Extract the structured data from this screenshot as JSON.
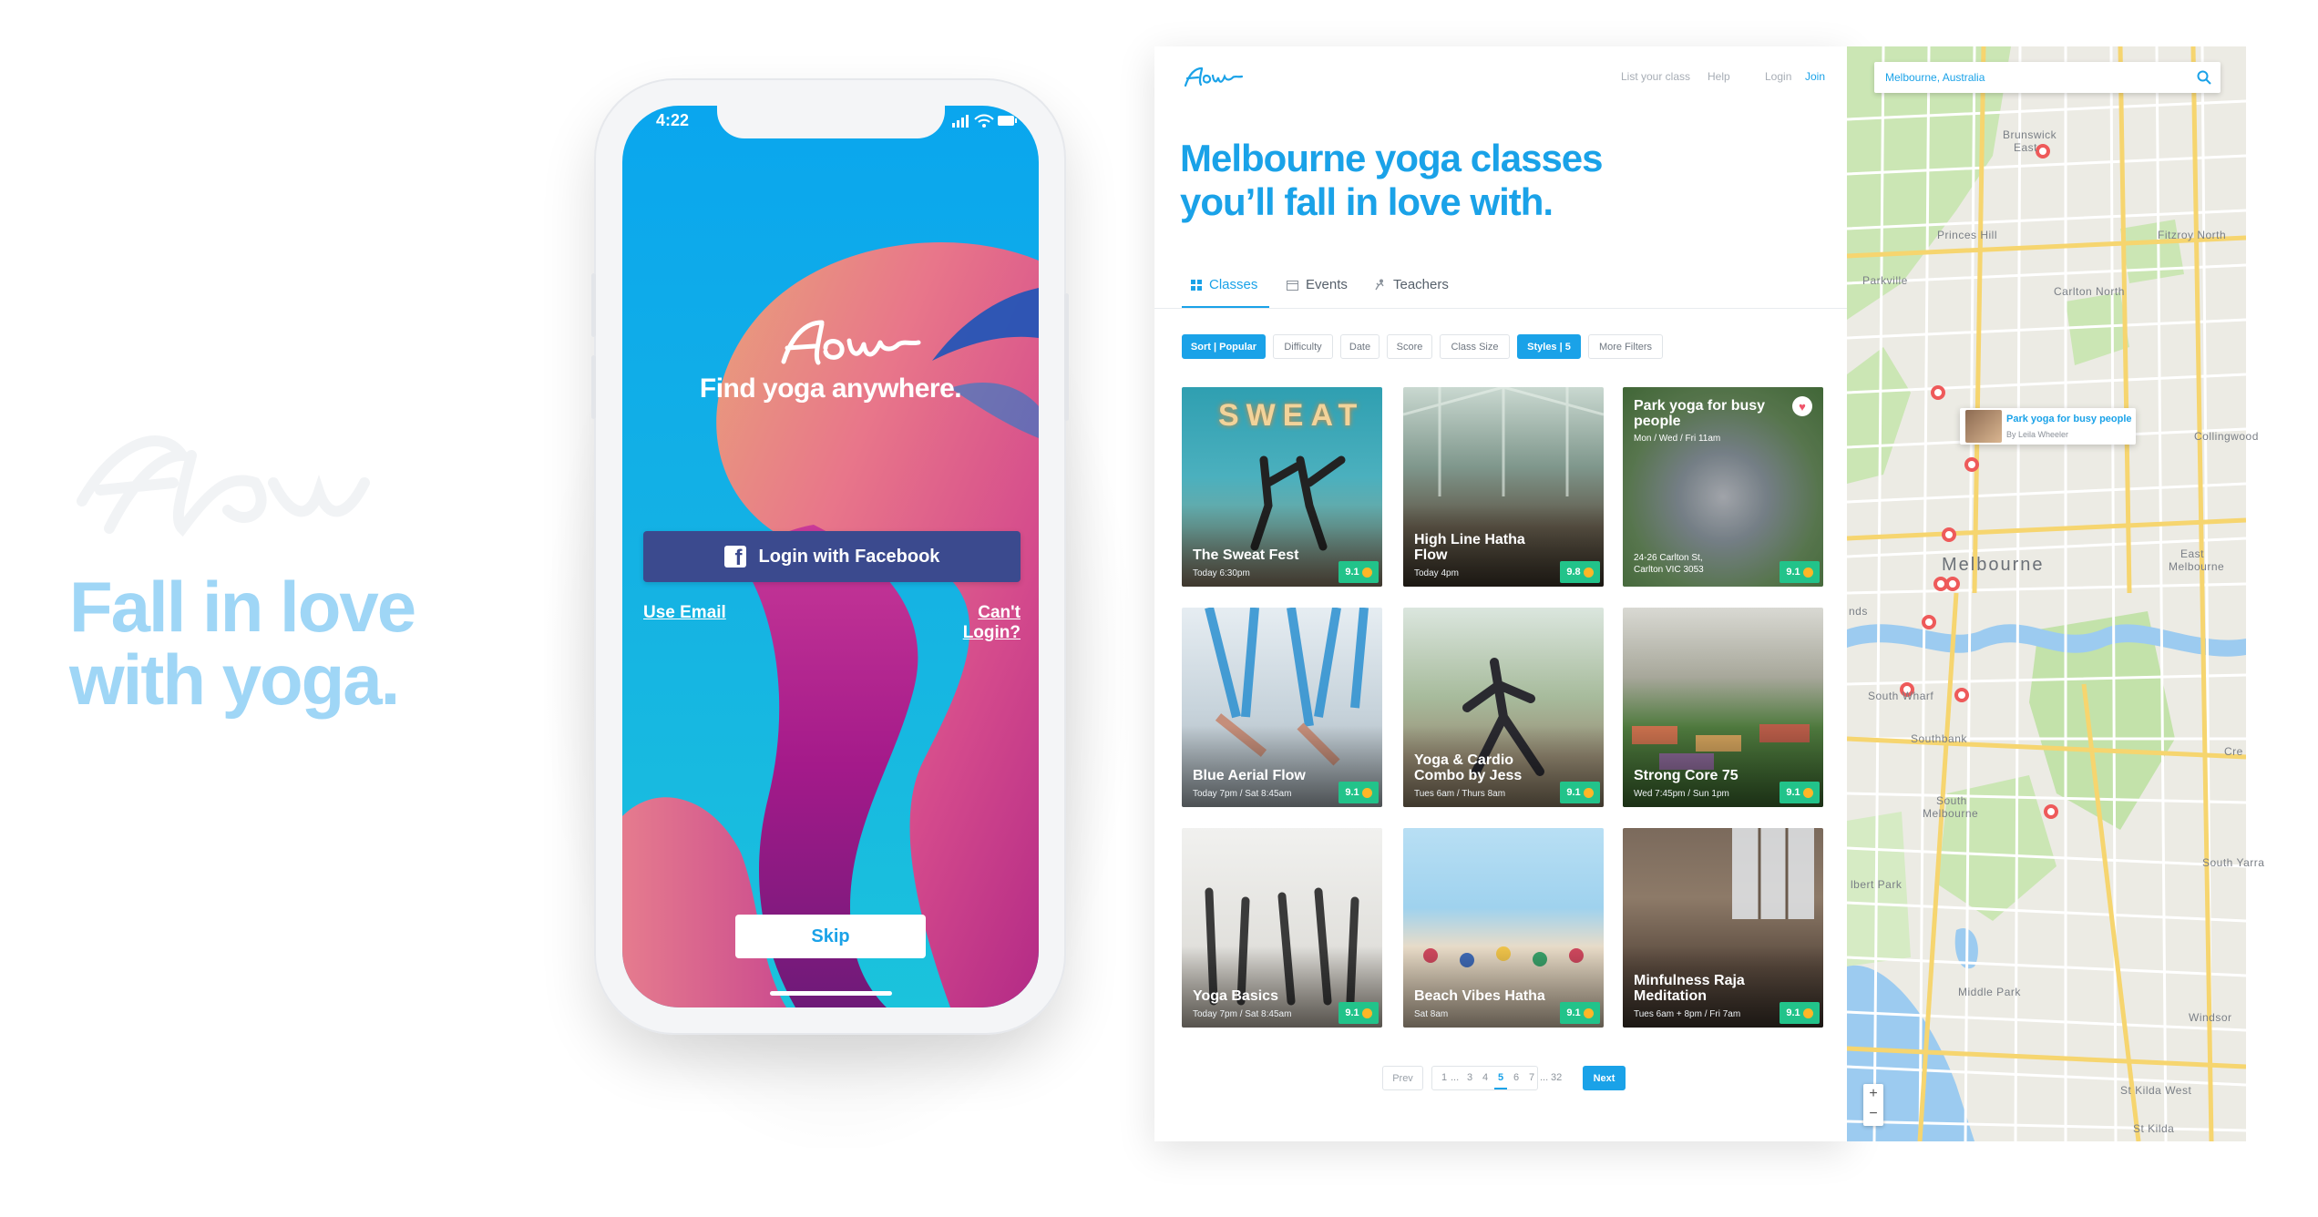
{
  "tagline": {
    "line1": "Fall in love",
    "line2": "with yoga."
  },
  "phone": {
    "status_time": "4:22",
    "app_name": "Flow",
    "subtitle": "Find yoga anywhere.",
    "facebook_label": "Login with Facebook",
    "use_email": "Use Email",
    "cant_login": "Can't Login?",
    "skip": "Skip"
  },
  "site": {
    "logo": "Flow",
    "nav": {
      "list_class": "List your class",
      "help": "Help",
      "login": "Login",
      "join": "Join"
    },
    "hero": {
      "line1": "Melbourne yoga classes",
      "line2": "you’ll fall in love with."
    },
    "tabs": [
      {
        "label": "Classes",
        "icon": "grid-icon"
      },
      {
        "label": "Events",
        "icon": "calendar-icon"
      },
      {
        "label": "Teachers",
        "icon": "person-icon"
      }
    ],
    "filters": {
      "sort": "Sort | Popular",
      "difficulty": "Difficulty",
      "date": "Date",
      "score": "Score",
      "class_size": "Class Size",
      "styles": "Styles | 5",
      "more": "More Filters"
    },
    "cards": [
      {
        "title": "The Sweat Fest",
        "time": "Today 6:30pm",
        "score": "9.1",
        "sign": "SWEAT"
      },
      {
        "title": "High Line Hatha Flow",
        "time": "Today 4pm",
        "score": "9.8"
      },
      {
        "title": "Park yoga for busy people",
        "time": "Mon / Wed / Fri 11am",
        "address1": "24-26 Carlton St,",
        "address2": "Carlton VIC 3053",
        "score": "9.1"
      },
      {
        "title": "Blue Aerial Flow",
        "time": "Today 7pm / Sat 8:45am",
        "score": "9.1"
      },
      {
        "title": "Yoga & Cardio Combo by Jess",
        "time": "Tues 6am / Thurs 8am",
        "score": "9.1"
      },
      {
        "title": "Strong Core 75",
        "time": "Wed 7:45pm / Sun 1pm",
        "score": "9.1"
      },
      {
        "title": "Yoga Basics",
        "time": "Today 7pm / Sat 8:45am",
        "score": "9.1"
      },
      {
        "title": "Beach Vibes Hatha",
        "time": "Sat 8am",
        "score": "9.1"
      },
      {
        "title": "Minfulness Raja Meditation",
        "time": "Tues 6am + 8pm / Fri 7am",
        "score": "9.1"
      }
    ],
    "pagination": {
      "prev": "Prev",
      "pages": [
        "1",
        "...",
        "3",
        "4",
        "5",
        "6",
        "7",
        "...",
        "32"
      ],
      "current": "5",
      "next": "Next"
    }
  },
  "map": {
    "search_value": "Melbourne, Australia",
    "labels": {
      "brunswick": "Brunswick",
      "brunswick_east": "East",
      "princes_hill": "Princes Hill",
      "fitzroy_north": "Fitzroy North",
      "parkville": "Parkville",
      "carlton_north": "Carlton North",
      "collingwood": "Collingwood",
      "melbourne": "Melbourne",
      "east_mel_1": "East",
      "east_mel_2": "Melbourne",
      "south_wharf": "South Wharf",
      "southbank": "Southbank",
      "south_mel_1": "South",
      "south_mel_2": "Melbourne",
      "south_yarra": "South Yarra",
      "albert_park": "lbert Park",
      "middle_park": "Middle Park",
      "windsor": "Windsor",
      "st_kilda_west": "St Kilda West",
      "st_kilda": "St Kilda",
      "edge_nds": "nds",
      "edge_cre": "Cre"
    },
    "popup": {
      "title": "Park yoga for busy people",
      "teacher": "By Leila Wheeler"
    },
    "zoom_in": "+",
    "zoom_out": "−"
  },
  "colors": {
    "brand_blue": "#1aa2e8",
    "facebook": "#3b4a8e",
    "score_green": "#22c38a",
    "pin_red": "#ee5a5a",
    "tagline": "#9fd6f6"
  }
}
